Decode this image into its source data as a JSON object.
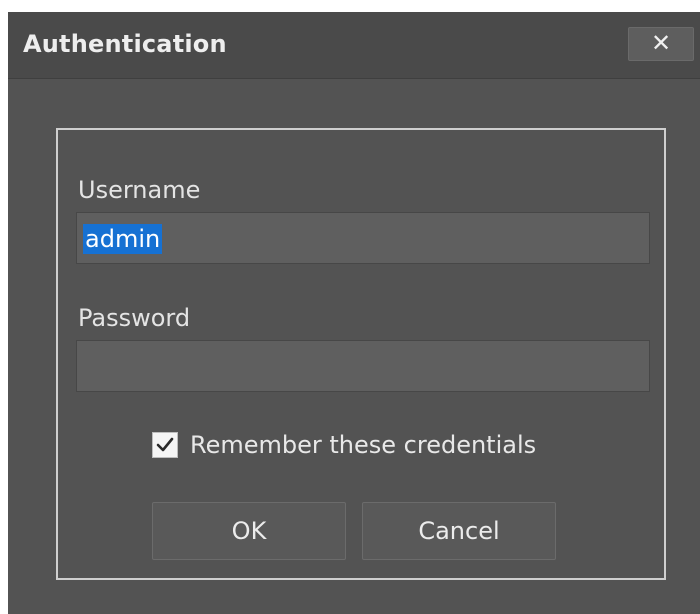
{
  "dialog": {
    "title": "Authentication",
    "close_label": "✕"
  },
  "form": {
    "username_label": "Username",
    "username_value": "admin",
    "password_label": "Password",
    "password_value": "",
    "remember_label": "Remember these credentials",
    "remember_checked": true
  },
  "buttons": {
    "ok_label": "OK",
    "cancel_label": "Cancel"
  },
  "icons": {
    "close": "close-icon",
    "check": "checkmark-icon"
  },
  "colors": {
    "dialog_bg": "#535353",
    "field_bg": "#5f5f5f",
    "selection": "#1671d3"
  }
}
